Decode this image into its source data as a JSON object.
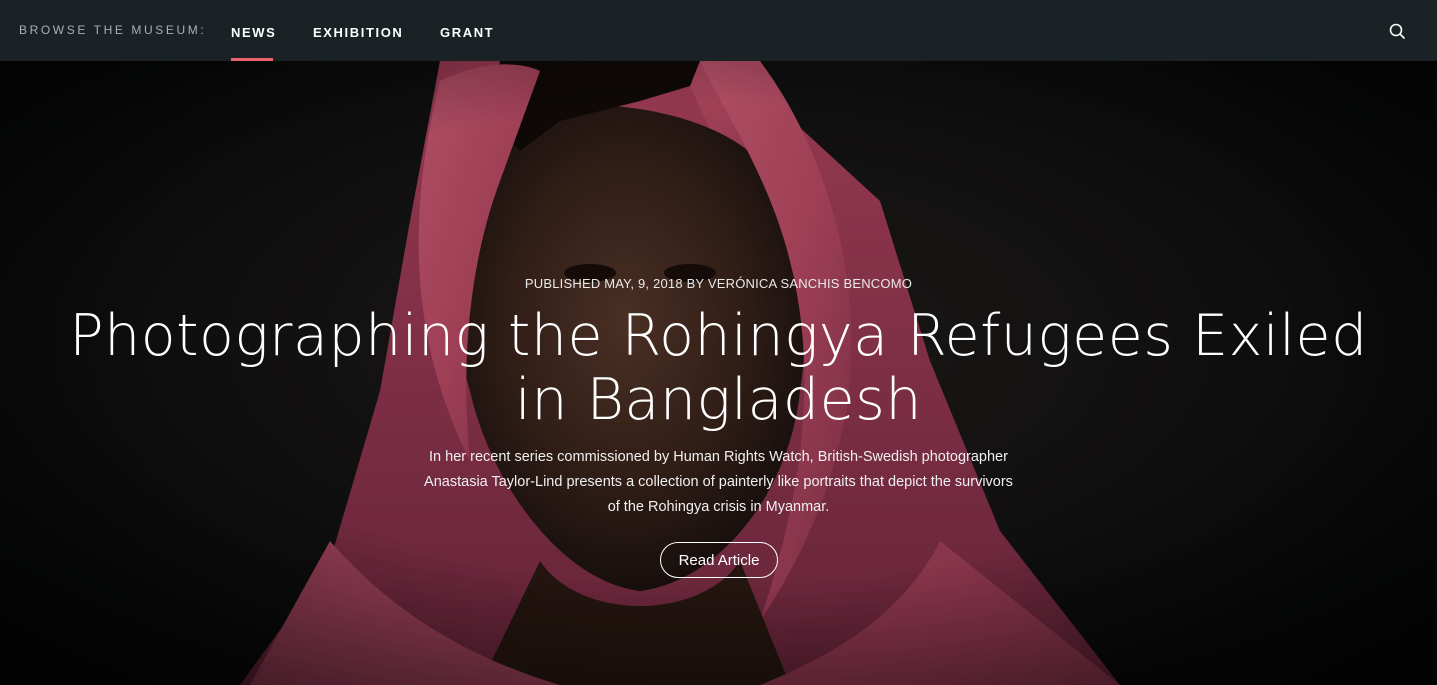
{
  "nav": {
    "browse_label": "BROWSE THE MUSEUM:",
    "items": [
      {
        "label": "NEWS",
        "active": true
      },
      {
        "label": "EXHIBITION",
        "active": false
      },
      {
        "label": "GRANT",
        "active": false
      }
    ],
    "search_icon": "search-icon",
    "accent_color": "#e8636b",
    "background_color": "#1b2225"
  },
  "hero": {
    "byline": "PUBLISHED MAY, 9, 2018 BY VERÓNICA SANCHIS BENCOMO",
    "title": "Photographing the Rohingya Refugees Exiled in Bangladesh",
    "summary": "In her recent series commissioned by Human Rights Watch, British-Swedish photographer Anastasia Taylor-Lind presents a collection of painterly like portraits that depict the survivors of the Rohingya crisis in Myanmar.",
    "cta_label": "Read Article",
    "scarf_color": "#c8546f"
  }
}
